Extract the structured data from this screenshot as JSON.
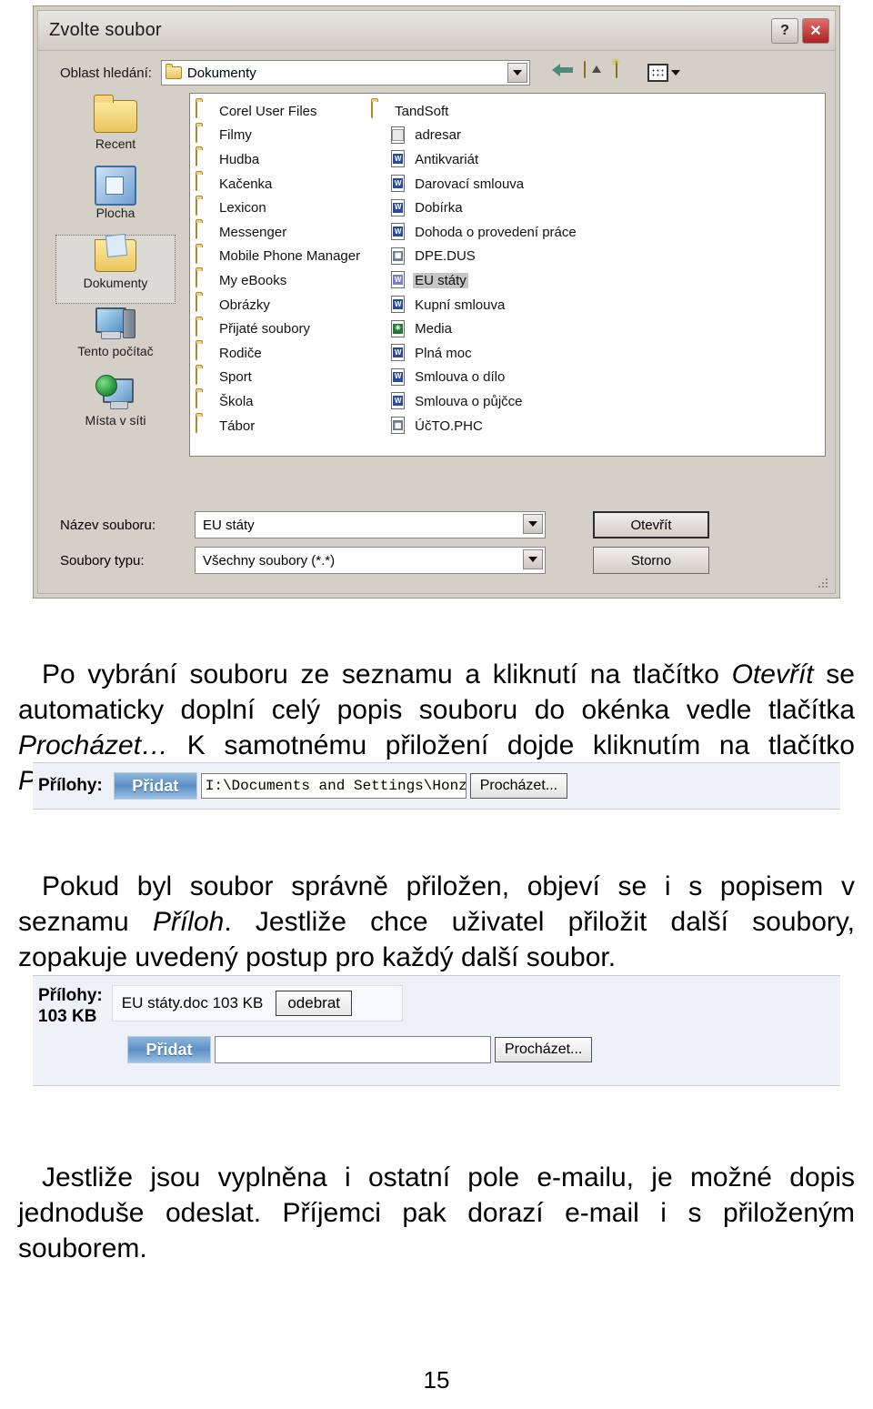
{
  "dialog": {
    "title": "Zvolte soubor",
    "help_button": "?",
    "close_button": "✕",
    "lookin_label": "Oblast hledání:",
    "lookin_value": "Dokumenty",
    "toolbar": {
      "back": "back-arrow-icon",
      "up": "up-one-level-icon",
      "new_folder": "new-folder-icon",
      "views": "views-icon"
    },
    "places": [
      {
        "label": "Recent",
        "icon": "folder-icon",
        "selected": false
      },
      {
        "label": "Plocha",
        "icon": "desktop-icon",
        "selected": false
      },
      {
        "label": "Dokumenty",
        "icon": "my-documents-icon",
        "selected": true
      },
      {
        "label": "Tento počítač",
        "icon": "my-computer-icon",
        "selected": false
      },
      {
        "label": "Místa v síti",
        "icon": "network-places-icon",
        "selected": false
      }
    ],
    "files_col1": [
      {
        "name": "Corel User Files",
        "type": "folder"
      },
      {
        "name": "Filmy",
        "type": "folder-video"
      },
      {
        "name": "Hudba",
        "type": "folder-music"
      },
      {
        "name": "Kačenka",
        "type": "folder"
      },
      {
        "name": "Lexicon",
        "type": "folder"
      },
      {
        "name": "Messenger",
        "type": "folder"
      },
      {
        "name": "Mobile Phone Manager",
        "type": "folder"
      },
      {
        "name": "My eBooks",
        "type": "folder"
      },
      {
        "name": "Obrázky",
        "type": "folder-pictures"
      },
      {
        "name": "Přijaté soubory",
        "type": "folder"
      },
      {
        "name": "Rodiče",
        "type": "folder"
      },
      {
        "name": "Sport",
        "type": "folder"
      },
      {
        "name": "Škola",
        "type": "folder"
      },
      {
        "name": "Tábor",
        "type": "folder"
      },
      {
        "name": "TandSoft",
        "type": "folder"
      }
    ],
    "files_col2": [
      {
        "name": "adresar",
        "type": "text",
        "badge": "",
        "selected": false
      },
      {
        "name": "Antikvariát",
        "type": "word",
        "badge": "W",
        "selected": false
      },
      {
        "name": "Darovací smlouva",
        "type": "word",
        "badge": "W",
        "selected": false
      },
      {
        "name": "Dobírka",
        "type": "word",
        "badge": "W",
        "selected": false
      },
      {
        "name": "Dohoda o provedení práce",
        "type": "word",
        "badge": "W",
        "selected": false
      },
      {
        "name": "DPE.DUS",
        "type": "data",
        "badge": "▦",
        "selected": false
      },
      {
        "name": "EU státy",
        "type": "word",
        "badge": "W",
        "selected": true
      },
      {
        "name": "Kupní smlouva",
        "type": "word",
        "badge": "W",
        "selected": false
      },
      {
        "name": "Media",
        "type": "green",
        "badge": "✳",
        "selected": false
      },
      {
        "name": "Plná moc",
        "type": "word",
        "badge": "W",
        "selected": false
      },
      {
        "name": "Smlouva o dílo",
        "type": "word",
        "badge": "W",
        "selected": false
      },
      {
        "name": "Smlouva o půjčce",
        "type": "word",
        "badge": "W",
        "selected": false
      },
      {
        "name": "ÚčTO.PHC",
        "type": "data",
        "badge": "▦",
        "selected": false
      }
    ],
    "filename_label": "Název souboru:",
    "filename_value": "EU státy",
    "filetype_label": "Soubory typu:",
    "filetype_value": "Všechny soubory (*.*)",
    "open_button": "Otevřít",
    "cancel_button": "Storno"
  },
  "paragraphs": {
    "p1_a": "Po vybrání souboru ze seznamu a kliknutí na tlačítko ",
    "p1_em1": "Otevřít",
    "p1_b": " se automaticky doplní celý popis souboru do okénka vedle tlačítka ",
    "p1_em2": "Procházet…",
    "p1_c": " K samotnému přiložení dojde kliknutím na tlačítko ",
    "p1_em3": "Přidat",
    "p1_d": ".",
    "p2_a": "Pokud byl soubor správně přiložen, objeví se i s popisem v seznamu ",
    "p2_em1": "Příloh",
    "p2_b": ". Jestliže chce uživatel přiložit další soubory, zopakuje uvedený postup pro každý další soubor.",
    "p3": "Jestliže jsou vyplněna i ostatní pole e-mailu, je možné dopis jednoduše odeslat. Příjemci pak dorazí e-mail i s přiloženým souborem."
  },
  "attach1": {
    "label": "Přílohy:",
    "add_button": "Přidat",
    "path_value": "I:\\Documents and Settings\\Honza",
    "browse_button": "Procházet..."
  },
  "attach2": {
    "label": "Přílohy:",
    "size": "103 KB",
    "file_name": "EU státy.doc  103 KB",
    "remove_button": "odebrat",
    "add_button": "Přidat",
    "path_value": "",
    "browse_button": "Procházet..."
  },
  "page_number": "15",
  "colors": {
    "dialog_face": "#d4d0c8",
    "attach_strip": "#eef2f8",
    "add_button_blue": "#5b8fc4",
    "selection_gray": "#c6c6c6",
    "close_red": "#b02020"
  }
}
